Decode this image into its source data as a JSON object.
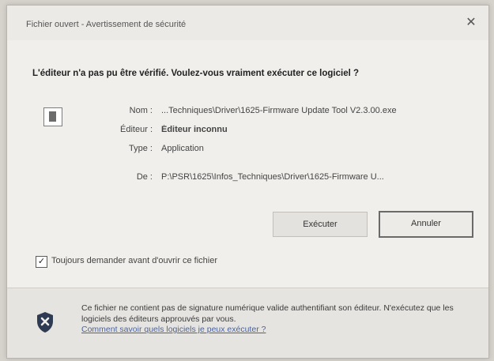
{
  "window": {
    "title": "Fichier ouvert - Avertissement de sécurité",
    "close_glyph": "✕"
  },
  "question": "L'éditeur n'a pas pu être vérifié. Voulez-vous vraiment exécuter ce logiciel ?",
  "details": {
    "name_label": "Nom :",
    "name_value": "...Techniques\\Driver\\1625-Firmware Update Tool V2.3.00.exe",
    "publisher_label": "Éditeur :",
    "publisher_value": "Éditeur inconnu",
    "type_label": "Type :",
    "type_value": "Application",
    "from_label": "De :",
    "from_value": "P:\\PSR\\1625\\Infos_Techniques\\Driver\\1625-Firmware U..."
  },
  "buttons": {
    "run": "Exécuter",
    "cancel": "Annuler"
  },
  "always_ask": {
    "checked": true,
    "label": "Toujours demander avant d'ouvrir ce fichier"
  },
  "footer": {
    "warning": "Ce fichier ne contient pas de signature numérique valide authentifiant son éditeur. N'exécutez que les logiciels des éditeurs approuvés par vous.",
    "link": "Comment savoir quels logiciels je peux exécuter ?"
  },
  "icons": {
    "app": "application-icon",
    "shield": "shield-warning-icon",
    "check": "✓"
  }
}
